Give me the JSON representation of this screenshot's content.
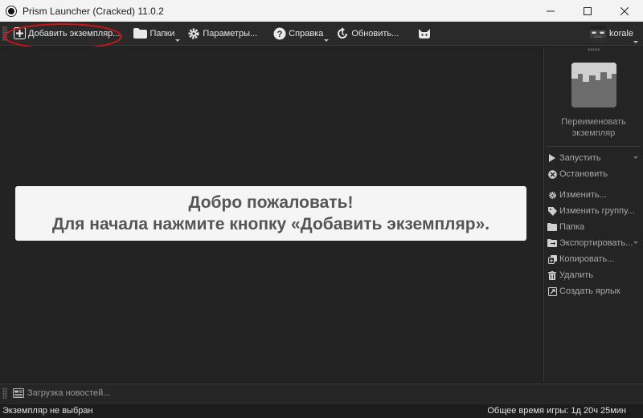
{
  "window": {
    "title": "Prism Launcher (Cracked) 11.0.2",
    "controls": [
      "minimize",
      "maximize",
      "close"
    ]
  },
  "toolbar": {
    "add_instance": "Добавить экземпляр...",
    "folders": "Папки",
    "settings": "Параметры...",
    "help": "Справка",
    "update": "Обновить...",
    "cat_icon": "cat-icon"
  },
  "account": {
    "name": "korale"
  },
  "welcome": {
    "line1": "Добро пожаловать!",
    "line2": "Для начала нажмите кнопку «Добавить экземпляр»."
  },
  "side": {
    "rename": "Переименовать экземпляр",
    "actions": [
      {
        "label": "Запустить",
        "icon": "play-icon"
      },
      {
        "label": "Остановить",
        "icon": "stop-icon"
      },
      {
        "label": "Изменить...",
        "icon": "gear-icon"
      },
      {
        "label": "Изменить группу...",
        "icon": "tag-icon"
      },
      {
        "label": "Папка",
        "icon": "folder-icon"
      },
      {
        "label": "Экспортировать...",
        "icon": "export-icon"
      },
      {
        "label": "Копировать...",
        "icon": "copy-icon"
      },
      {
        "label": "Удалить",
        "icon": "trash-icon"
      },
      {
        "label": "Создать ярлык",
        "icon": "shortcut-icon"
      }
    ]
  },
  "news": {
    "label": "Загрузка новостей..."
  },
  "status": {
    "left": "Экземпляр не выбран",
    "right": "Общее время игры: 1д 20ч 25мин"
  },
  "colors": {
    "background": "#232323",
    "welcome_bg": "#f5f5f5",
    "highlight": "#dd1111"
  }
}
